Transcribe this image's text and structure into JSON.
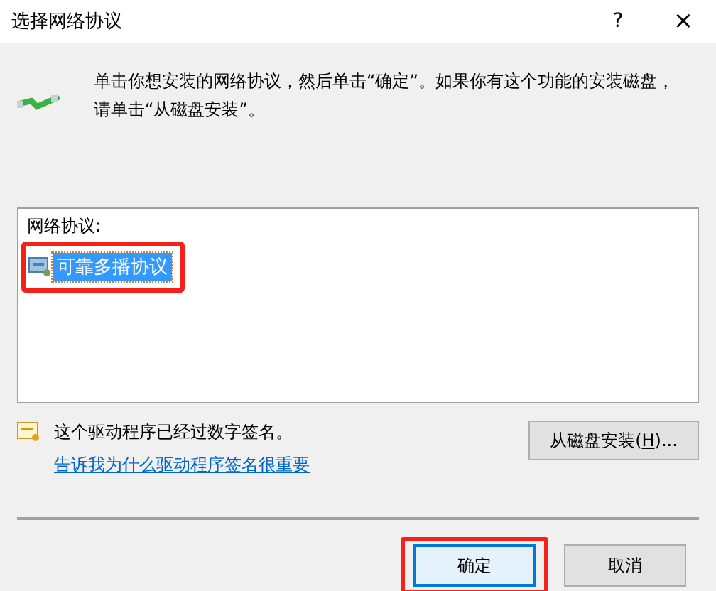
{
  "window": {
    "title": "选择网络协议",
    "help": "?",
    "close": "×"
  },
  "instruction": "单击你想安装的网络协议，然后单击“确定”。如果你有这个功能的安装磁盘，请单击“从磁盘安装”。",
  "list": {
    "header": "网络协议:",
    "items": [
      {
        "label": "可靠多播协议",
        "selected": true,
        "annotated": true
      }
    ]
  },
  "signature": {
    "text": "这个驱动程序已经过数字签名。",
    "link": "告诉我为什么驱动程序签名很重要"
  },
  "disk_button": {
    "label_before": "从磁盘安装(",
    "accelerator": "H",
    "label_after": ")..."
  },
  "buttons": [
    {
      "label": "确定",
      "default": true,
      "annotated": true
    },
    {
      "label": "取消",
      "default": false,
      "annotated": false
    }
  ]
}
